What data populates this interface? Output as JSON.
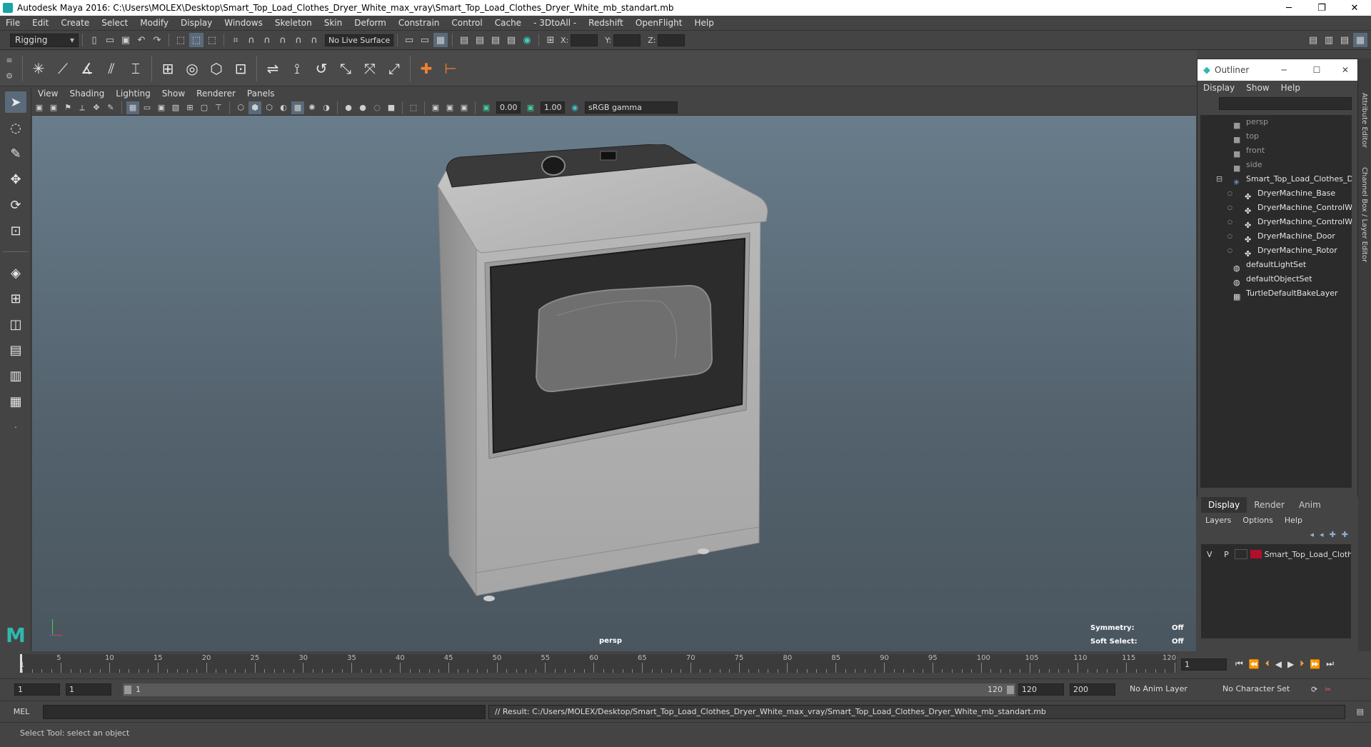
{
  "window": {
    "title": "Autodesk Maya 2016: C:\\Users\\MOLEX\\Desktop\\Smart_Top_Load_Clothes_Dryer_White_max_vray\\Smart_Top_Load_Clothes_Dryer_White_mb_standart.mb"
  },
  "menubar": [
    "File",
    "Edit",
    "Create",
    "Select",
    "Modify",
    "Display",
    "Windows",
    "Skeleton",
    "Skin",
    "Deform",
    "Constrain",
    "Control",
    "Cache",
    "- 3DtoAll -",
    "Redshift",
    "OpenFlight",
    "Help"
  ],
  "status_line": {
    "mode": "Rigging",
    "live_surface": "No Live Surface",
    "x_label": "X:",
    "y_label": "Y:",
    "z_label": "Z:"
  },
  "viewport": {
    "menu": [
      "View",
      "Shading",
      "Lighting",
      "Show",
      "Renderer",
      "Panels"
    ],
    "exposure": "0.00",
    "gamma": "1.00",
    "color_space": "sRGB gamma",
    "camera_label": "persp",
    "symmetry_label": "Symmetry:",
    "symmetry_value": "Off",
    "soft_select_label": "Soft Select:",
    "soft_select_value": "Off"
  },
  "outliner": {
    "title": "Outliner",
    "menu": [
      "Display",
      "Show",
      "Help"
    ],
    "items": [
      {
        "label": "persp",
        "type": "camera",
        "dim": true,
        "indent": 0
      },
      {
        "label": "top",
        "type": "camera",
        "dim": true,
        "indent": 0
      },
      {
        "label": "front",
        "type": "camera",
        "dim": true,
        "indent": 0
      },
      {
        "label": "side",
        "type": "camera",
        "dim": true,
        "indent": 0
      },
      {
        "label": "Smart_Top_Load_Clothes_Dr",
        "type": "group",
        "dim": false,
        "indent": 0
      },
      {
        "label": "DryerMachine_Base",
        "type": "mesh",
        "dim": false,
        "indent": 1
      },
      {
        "label": "DryerMachine_ControlW",
        "type": "mesh",
        "dim": false,
        "indent": 1
      },
      {
        "label": "DryerMachine_ControlW",
        "type": "mesh",
        "dim": false,
        "indent": 1
      },
      {
        "label": "DryerMachine_Door",
        "type": "mesh",
        "dim": false,
        "indent": 1
      },
      {
        "label": "DryerMachine_Rotor",
        "type": "mesh",
        "dim": false,
        "indent": 1
      },
      {
        "label": "defaultLightSet",
        "type": "set",
        "dim": false,
        "indent": 0
      },
      {
        "label": "defaultObjectSet",
        "type": "set",
        "dim": false,
        "indent": 0
      },
      {
        "label": "TurtleDefaultBakeLayer",
        "type": "layer",
        "dim": false,
        "indent": 0
      }
    ]
  },
  "side_tabs": {
    "attribute_editor": "Attribute Editor",
    "channel_box": "Channel Box / Layer Editor"
  },
  "layer_editor": {
    "tabs": [
      "Display",
      "Render",
      "Anim"
    ],
    "menu": [
      "Layers",
      "Options",
      "Help"
    ],
    "layer": {
      "v": "V",
      "p": "P",
      "name": "Smart_Top_Load_Cloth",
      "color": "#b0102a"
    }
  },
  "timeline": {
    "ticks": [
      "5",
      "10",
      "15",
      "20",
      "25",
      "30",
      "35",
      "40",
      "45",
      "50",
      "55",
      "60",
      "65",
      "70",
      "75",
      "80",
      "85",
      "90",
      "95",
      "100",
      "105",
      "110",
      "115",
      "120"
    ],
    "start_label": "1",
    "current_frame": "1"
  },
  "range": {
    "start": "1",
    "playback_start": "1",
    "slider_start": "1",
    "slider_end": "120",
    "playback_end": "120",
    "end": "200",
    "anim_layer": "No Anim Layer",
    "character_set": "No Character Set"
  },
  "command": {
    "label": "MEL",
    "result": "// Result: C:/Users/MOLEX/Desktop/Smart_Top_Load_Clothes_Dryer_White_max_vray/Smart_Top_Load_Clothes_Dryer_White_mb_standart.mb"
  },
  "help_line": "Select Tool: select an object"
}
